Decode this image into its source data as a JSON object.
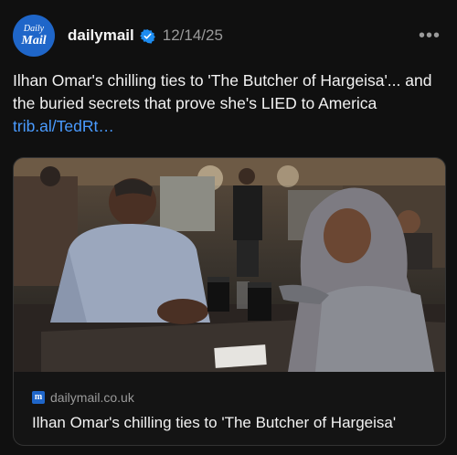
{
  "post": {
    "avatar_line1": "Daily",
    "avatar_line2": "Mail",
    "author": "dailymail",
    "timestamp": "12/14/25",
    "more_label": "•••",
    "text": "Ilhan Omar's chilling ties to 'The Butcher of Hargeisa'... and the buried secrets that prove she's LIED to America",
    "link_text": "trib.al/TedRt…"
  },
  "card": {
    "domain": "dailymail.co.uk",
    "domain_icon_text": "m",
    "title": "Ilhan Omar's chilling ties to 'The Butcher of Hargeisa'"
  },
  "colors": {
    "background": "#101010",
    "link": "#4a9bff",
    "verified": "#1d8cf0",
    "avatar": "#1f66c9"
  },
  "icons": [
    "verified-icon",
    "more-options-icon",
    "dailymail-favicon-icon"
  ]
}
